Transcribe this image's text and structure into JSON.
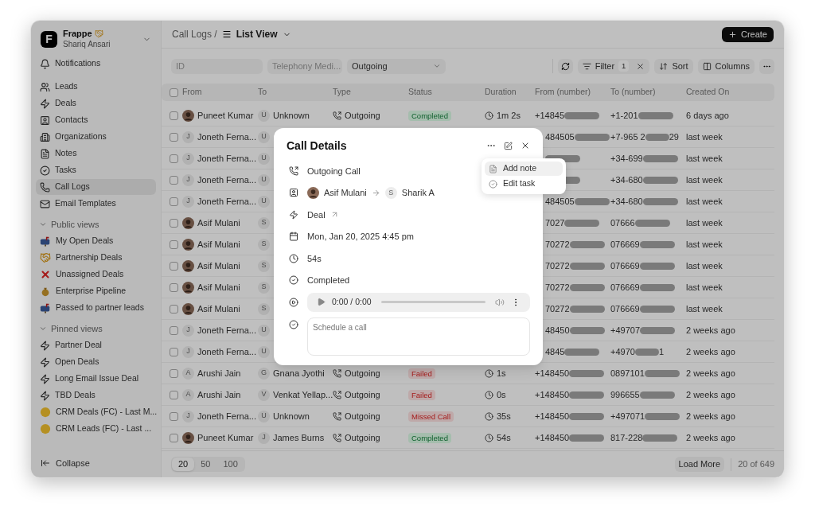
{
  "workspace": {
    "logo": "F",
    "name": "Frappe",
    "user": "Shariq Ansari"
  },
  "sidebar": {
    "top": [
      {
        "label": "Notifications",
        "kind": "bell",
        "selected": false
      }
    ],
    "nav": [
      {
        "label": "Leads",
        "kind": "users",
        "selected": false
      },
      {
        "label": "Deals",
        "kind": "bolt",
        "selected": false
      },
      {
        "label": "Contacts",
        "kind": "contact",
        "selected": false
      },
      {
        "label": "Organizations",
        "kind": "building",
        "selected": false
      },
      {
        "label": "Notes",
        "kind": "note",
        "selected": false
      },
      {
        "label": "Tasks",
        "kind": "task",
        "selected": false
      },
      {
        "label": "Call Logs",
        "kind": "phone",
        "selected": true
      },
      {
        "label": "Email Templates",
        "kind": "mail",
        "selected": false
      }
    ],
    "sections": [
      {
        "title": "Public views",
        "expanded": true,
        "items": [
          {
            "label": "My Open Deals",
            "kind": "mailbox",
            "selected": false
          },
          {
            "label": "Partnership Deals",
            "kind": "handshake",
            "selected": false
          },
          {
            "label": "Unassigned Deals",
            "kind": "cross",
            "selected": false
          },
          {
            "label": "Enterprise Pipeline",
            "kind": "moneybag",
            "selected": false
          },
          {
            "label": "Passed to partner leads",
            "kind": "mailbox",
            "selected": false
          }
        ]
      },
      {
        "title": "Pinned views",
        "expanded": true,
        "items": [
          {
            "label": "Partner Deal",
            "kind": "bolt",
            "selected": false
          },
          {
            "label": "Open Deals",
            "kind": "bolt",
            "selected": false
          },
          {
            "label": "Long Email Issue Deal",
            "kind": "bolt",
            "selected": false
          },
          {
            "label": "TBD Deals",
            "kind": "bolt",
            "selected": false
          },
          {
            "label": "CRM Deals (FC) - Last M...",
            "kind": "face",
            "selected": false
          },
          {
            "label": "CRM Leads (FC) - Last ...",
            "kind": "face",
            "selected": false
          }
        ]
      }
    ],
    "collapse": "Collapse"
  },
  "header": {
    "parent": "Call Logs /",
    "view": "List View",
    "create": "Create"
  },
  "filters": [
    {
      "kind": "text",
      "placeholder": "ID"
    },
    {
      "kind": "select",
      "placeholder": "Telephony Medi..."
    },
    {
      "kind": "select",
      "value": "Outgoing"
    }
  ],
  "toolbar": {
    "filter": "Filter",
    "filter_count": "1",
    "sort": "Sort",
    "columns": "Columns"
  },
  "table": {
    "select_all": {
      "checked": false
    },
    "columns": [
      "From",
      "To",
      "Type",
      "Status",
      "Duration",
      "From (number)",
      "To (number)",
      "Created On"
    ],
    "rows": [
      {
        "checked": false,
        "from": {
          "kind": "photo",
          "name": "Puneet Kumar"
        },
        "to": {
          "initial": "U",
          "name": "Unknown"
        },
        "type": "Outgoing",
        "status": {
          "label": "Completed",
          "kind": "success"
        },
        "duration": "1m 2s",
        "from_number": "+14845",
        "to_number": "+1-201",
        "created": "6 days ago"
      },
      {
        "checked": false,
        "from": {
          "kind": "letter",
          "initial": "J",
          "name": "Joneth Ferna..."
        },
        "to": {
          "initial": "U"
        },
        "from_number": "484505",
        "to_number": "+7-965 2",
        "to_number_end": "29",
        "created": "last week"
      },
      {
        "checked": false,
        "from": {
          "kind": "letter",
          "initial": "J",
          "name": "Joneth Ferna..."
        },
        "to": {
          "initial": "U"
        },
        "to_number": "+34-699",
        "created": "last week"
      },
      {
        "checked": false,
        "from": {
          "kind": "letter",
          "initial": "J",
          "name": "Joneth Ferna..."
        },
        "to": {
          "initial": "U"
        },
        "to_number": "+34-680",
        "created": "last week"
      },
      {
        "checked": false,
        "from": {
          "kind": "letter",
          "initial": "J",
          "name": "Joneth Ferna..."
        },
        "to": {
          "initial": "U"
        },
        "from_number": "484505",
        "to_number": "+34-680",
        "created": "last week"
      },
      {
        "checked": false,
        "from": {
          "kind": "photo",
          "name": "Asif Mulani"
        },
        "to": {
          "initial": "S"
        },
        "from_number": "7027",
        "to_number": "07666",
        "created": "last week"
      },
      {
        "checked": false,
        "from": {
          "kind": "photo",
          "name": "Asif Mulani"
        },
        "to": {
          "initial": "S"
        },
        "from_number": "70272",
        "to_number": "076669",
        "created": "last week"
      },
      {
        "checked": false,
        "from": {
          "kind": "photo",
          "name": "Asif Mulani"
        },
        "to": {
          "initial": "S"
        },
        "from_number": "70272",
        "to_number": "076669",
        "created": "last week"
      },
      {
        "checked": false,
        "from": {
          "kind": "photo",
          "name": "Asif Mulani"
        },
        "to": {
          "initial": "S"
        },
        "from_number": "70272",
        "to_number": "076669",
        "created": "last week"
      },
      {
        "checked": false,
        "from": {
          "kind": "photo",
          "name": "Asif Mulani"
        },
        "to": {
          "initial": "S"
        },
        "from_number": "70272",
        "to_number": "076669",
        "created": "last week"
      },
      {
        "checked": false,
        "from": {
          "kind": "letter",
          "initial": "J",
          "name": "Joneth Ferna..."
        },
        "to": {
          "initial": "U"
        },
        "from_number": "48450",
        "to_number": "+49707",
        "created": "2 weeks ago"
      },
      {
        "checked": false,
        "from": {
          "kind": "letter",
          "initial": "J",
          "name": "Joneth Ferna..."
        },
        "to": {
          "initial": "U"
        },
        "from_number": "4845",
        "to_number": "+4970",
        "to_number_end": "1",
        "created": "2 weeks ago"
      },
      {
        "checked": false,
        "from": {
          "kind": "letter",
          "initial": "A",
          "name": "Arushi Jain"
        },
        "to": {
          "initial": "G",
          "name": "Gnana Jyothi"
        },
        "type": "Outgoing",
        "status": {
          "label": "Failed",
          "kind": "error"
        },
        "duration": "1s",
        "from_number": "+148450",
        "to_number": "0897101",
        "created": "2 weeks ago"
      },
      {
        "checked": false,
        "from": {
          "kind": "letter",
          "initial": "A",
          "name": "Arushi Jain"
        },
        "to": {
          "initial": "V",
          "name": "Venkat Yellap..."
        },
        "type": "Outgoing",
        "status": {
          "label": "Failed",
          "kind": "error"
        },
        "duration": "0s",
        "from_number": "+148450",
        "to_number": "996655",
        "created": "2 weeks ago"
      },
      {
        "checked": false,
        "from": {
          "kind": "letter",
          "initial": "J",
          "name": "Joneth Ferna..."
        },
        "to": {
          "initial": "U",
          "name": "Unknown"
        },
        "type": "Outgoing",
        "status": {
          "label": "Missed Call",
          "kind": "error"
        },
        "duration": "35s",
        "from_number": "+148450",
        "to_number": "+497071",
        "created": "2 weeks ago"
      },
      {
        "checked": false,
        "from": {
          "kind": "photo",
          "name": "Puneet Kumar"
        },
        "to": {
          "initial": "J",
          "name": "James Burns"
        },
        "type": "Outgoing",
        "status": {
          "label": "Completed",
          "kind": "success"
        },
        "duration": "54s",
        "from_number": "+148450",
        "to_number": "817-228",
        "created": "2 weeks ago"
      }
    ]
  },
  "footer": {
    "page_sizes": [
      {
        "label": "20",
        "selected": true
      },
      {
        "label": "50",
        "selected": false
      },
      {
        "label": "100",
        "selected": false
      }
    ],
    "load_more": "Load More",
    "count": "20 of 649"
  },
  "modal": {
    "title": "Call Details",
    "fields": [
      {
        "kind": "type",
        "text": "Outgoing Call"
      },
      {
        "kind": "parties",
        "caller": "Asif Mulani",
        "receiver_initial": "S",
        "receiver": "Sharik A"
      },
      {
        "kind": "link",
        "text": "Deal"
      },
      {
        "kind": "date",
        "text": "Mon, Jan 20, 2025 4:45 pm"
      },
      {
        "kind": "duration",
        "text": "54s"
      },
      {
        "kind": "status",
        "text": "Completed"
      },
      {
        "kind": "recording",
        "time": "0:00 / 0:00",
        "level": 0
      },
      {
        "kind": "note",
        "placeholder": "Schedule a call"
      }
    ],
    "menu": [
      {
        "label": "Add note",
        "kind": "note",
        "selected": true
      },
      {
        "label": "Edit task",
        "kind": "task",
        "selected": false
      }
    ]
  }
}
